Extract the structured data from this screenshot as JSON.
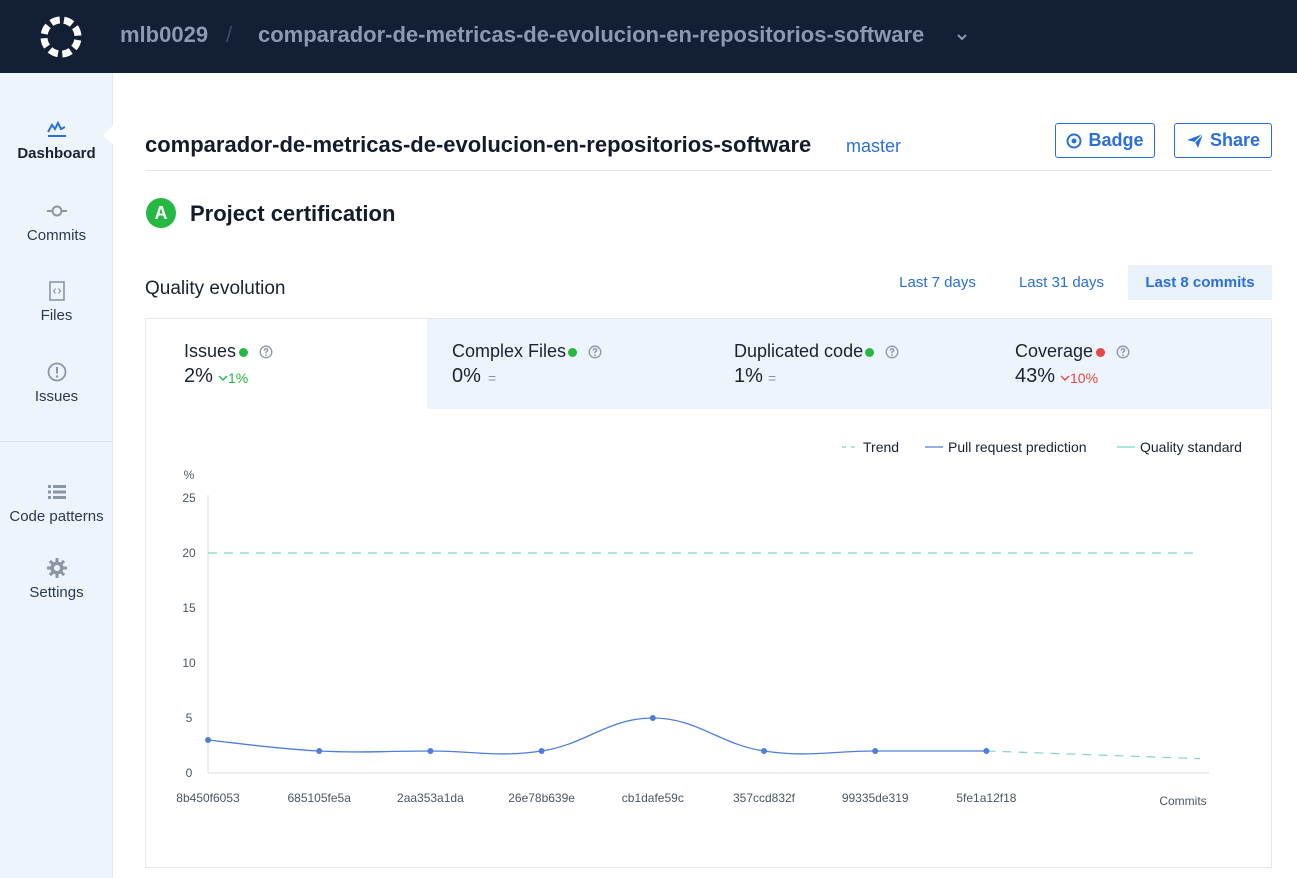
{
  "topbar": {
    "owner": "mlb0029",
    "separator": "/",
    "repo": "comparador-de-metricas-de-evolucion-en-repositorios-software"
  },
  "sidebar": {
    "items": [
      {
        "label": "Dashboard",
        "icon": "dashboard-chart-icon",
        "active": true
      },
      {
        "label": "Commits",
        "icon": "commit-icon"
      },
      {
        "label": "Files",
        "icon": "file-code-icon"
      },
      {
        "label": "Issues",
        "icon": "alert-circle-icon"
      },
      {
        "label": "Code patterns",
        "icon": "list-icon"
      },
      {
        "label": "Settings",
        "icon": "gear-icon"
      }
    ]
  },
  "header": {
    "title": "comparador-de-metricas-de-evolucion-en-repositorios-software",
    "branch": "master",
    "badge_label": "Badge",
    "share_label": "Share"
  },
  "certification": {
    "grade": "A",
    "title": "Project certification",
    "grade_color": "#25b944"
  },
  "quality": {
    "title": "Quality evolution",
    "ranges": [
      "Last 7 days",
      "Last 31 days",
      "Last 8 commits"
    ],
    "selected_range": "Last 8 commits",
    "metrics": [
      {
        "label": "Issues",
        "value": "2%",
        "delta": "1%",
        "status": "good",
        "selected": true
      },
      {
        "label": "Complex Files",
        "value": "0%",
        "delta": "=",
        "status": "good"
      },
      {
        "label": "Duplicated code",
        "value": "1%",
        "delta": "=",
        "status": "good"
      },
      {
        "label": "Coverage",
        "value": "43%",
        "delta": "10%",
        "status": "bad"
      }
    ],
    "legend": [
      "Trend",
      "Pull request prediction",
      "Quality standard"
    ]
  },
  "colors": {
    "accent": "#2a6fdb",
    "good": "#25b944",
    "bad": "#e84545",
    "standard_line": "#7fd6c8",
    "topbar": "#131f35"
  },
  "chart_data": {
    "type": "line",
    "ylabel": "%",
    "xlabel": "Commits",
    "ylim": [
      0,
      25
    ],
    "yticks": [
      0,
      5,
      10,
      15,
      20,
      25
    ],
    "categories": [
      "8b450f6053",
      "685105fe5a",
      "2aa353a1da",
      "26e78b639e",
      "cb1dafe59c",
      "357ccd832f",
      "99335de319",
      "5fe1a12f18"
    ],
    "series": [
      {
        "values": [
          3,
          2,
          2,
          2,
          5,
          2,
          2,
          2
        ]
      }
    ],
    "quality_standard": 20,
    "trend_end": 1.3,
    "legend_position": "top-right",
    "grid": false
  }
}
